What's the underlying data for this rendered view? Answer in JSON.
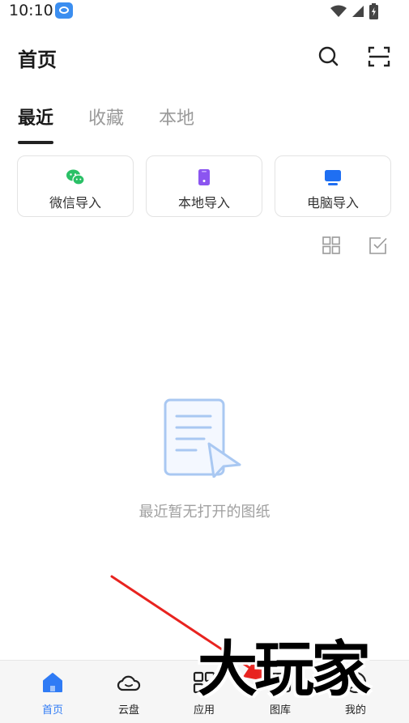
{
  "status_bar": {
    "time": "10:10",
    "icons": [
      "app-notification-icon",
      "wifi-icon",
      "cellular-signal-icon",
      "battery-charging-icon"
    ]
  },
  "header": {
    "title": "首页",
    "actions": [
      "search-icon",
      "scan-icon"
    ]
  },
  "tabs": [
    {
      "label": "最近",
      "active": true
    },
    {
      "label": "收藏",
      "active": false
    },
    {
      "label": "本地",
      "active": false
    }
  ],
  "import_cards": [
    {
      "label": "微信导入",
      "icon": "wechat-icon",
      "color": "#2ac066"
    },
    {
      "label": "本地导入",
      "icon": "phone-icon",
      "color": "#8b55f0"
    },
    {
      "label": "电脑导入",
      "icon": "monitor-icon",
      "color": "#1f6ff2"
    }
  ],
  "view_controls": [
    "grid-view-icon",
    "select-checkbox-icon"
  ],
  "empty_state": {
    "message": "最近暂无打开的图纸",
    "icon": "document-pointer-icon"
  },
  "bottom_nav": [
    {
      "label": "首页",
      "icon": "home-icon",
      "active": true
    },
    {
      "label": "云盘",
      "icon": "cloud-icon",
      "active": false
    },
    {
      "label": "应用",
      "icon": "apps-grid-icon",
      "active": false
    },
    {
      "label": "图库",
      "icon": "gallery-icon",
      "active": false
    },
    {
      "label": "我的",
      "icon": "profile-icon",
      "active": false
    }
  ],
  "watermark": "大玩家",
  "colors": {
    "accent": "#2f7bf5",
    "annotation_arrow": "#e8231f"
  }
}
